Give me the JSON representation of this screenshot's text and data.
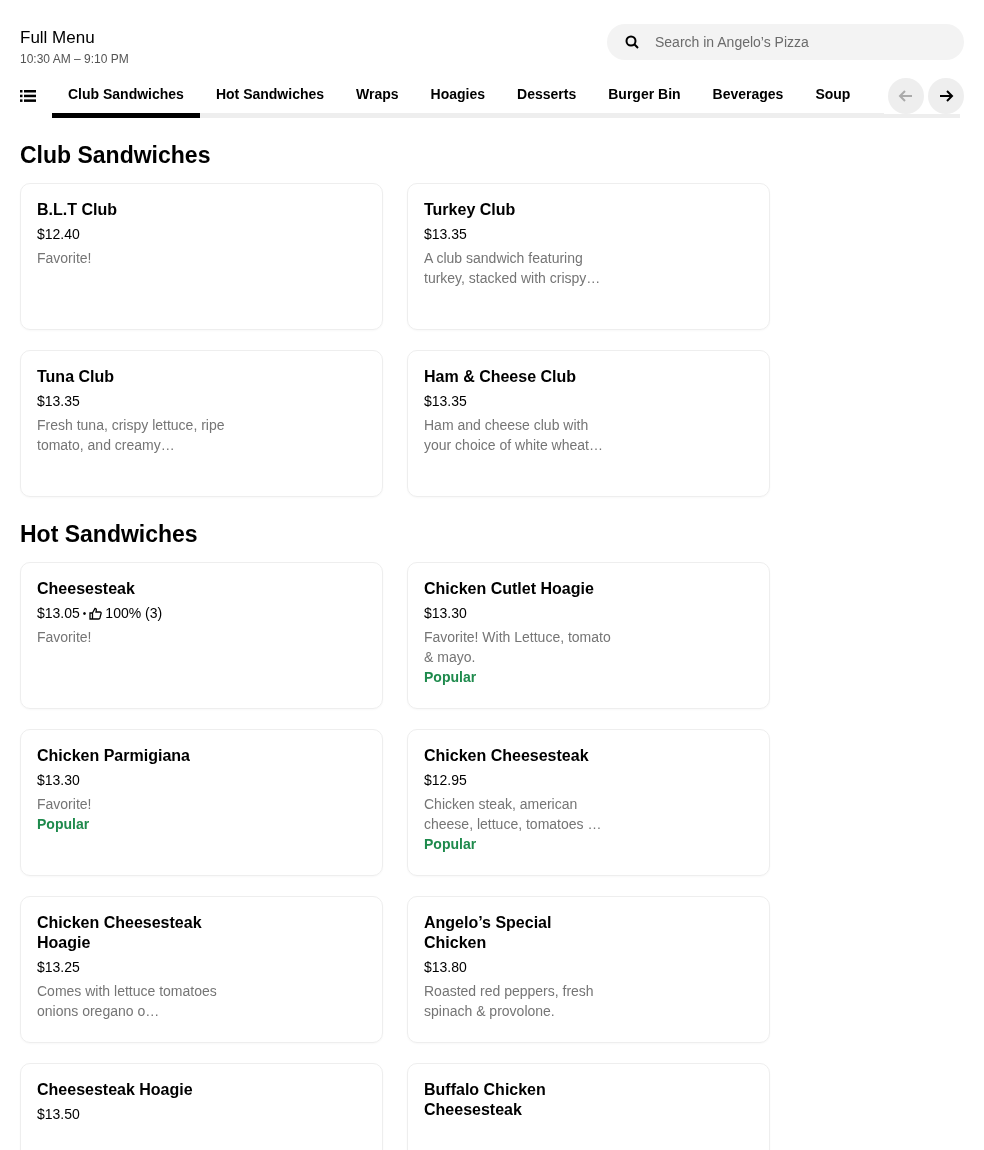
{
  "header": {
    "title": "Full Menu",
    "hours": "10:30 AM – 9:10 PM"
  },
  "search": {
    "placeholder": "Search in Angelo’s Pizza"
  },
  "tabs": [
    {
      "label": "Club Sandwiches",
      "selected": true
    },
    {
      "label": "Hot Sandwiches",
      "selected": false
    },
    {
      "label": "Wraps",
      "selected": false
    },
    {
      "label": "Hoagies",
      "selected": false
    },
    {
      "label": "Desserts",
      "selected": false
    },
    {
      "label": "Burger Bin",
      "selected": false
    },
    {
      "label": "Beverages",
      "selected": false
    },
    {
      "label": "Soup",
      "selected": false
    }
  ],
  "scroll_buttons": [
    {
      "kind": "back",
      "disabled": true
    },
    {
      "kind": "forward",
      "disabled": false
    }
  ],
  "sections": [
    {
      "title": "Club Sandwiches",
      "items": [
        {
          "name": "B.L.T Club",
          "price": "$12.40",
          "description": "Favorite!"
        },
        {
          "name": "Turkey Club",
          "price": "$13.35",
          "description": "A club sandwich featuring turkey, stacked with crispy…"
        },
        {
          "name": "Tuna Club",
          "price": "$13.35",
          "description": "Fresh tuna, crispy lettuce, ripe tomato, and creamy…"
        },
        {
          "name": "Ham & Cheese Club",
          "price": "$13.35",
          "description": "Ham and cheese club with your choice of white wheat…"
        }
      ]
    },
    {
      "title": "Hot Sandwiches",
      "items": [
        {
          "name": "Cheesesteak",
          "price": "$13.05",
          "separator": "•",
          "rating": "100% (3)",
          "description": "Favorite!"
        },
        {
          "name": "Chicken Cutlet Hoagie",
          "price": "$13.30",
          "description": "Favorite! With Lettuce, tomato & mayo.",
          "badge": "Popular"
        },
        {
          "name": "Chicken Parmigiana",
          "price": "$13.30",
          "description": "Favorite!",
          "badge": "Popular"
        },
        {
          "name": "Chicken Cheesesteak",
          "price": "$12.95",
          "description": "Chicken steak, american cheese, lettuce, tomatoes …",
          "badge": "Popular"
        },
        {
          "name": "Chicken Cheesesteak Hoagie",
          "price": "$13.25",
          "description": "Comes with lettuce tomatoes onions oregano o…"
        },
        {
          "name": "Angelo’s Special Chicken",
          "price": "$13.80",
          "description": "Roasted red peppers, fresh spinach & provolone."
        },
        {
          "name": "Cheesesteak Hoagie",
          "price": "$13.50"
        },
        {
          "name": "Buffalo Chicken Cheesesteak"
        }
      ]
    }
  ]
}
